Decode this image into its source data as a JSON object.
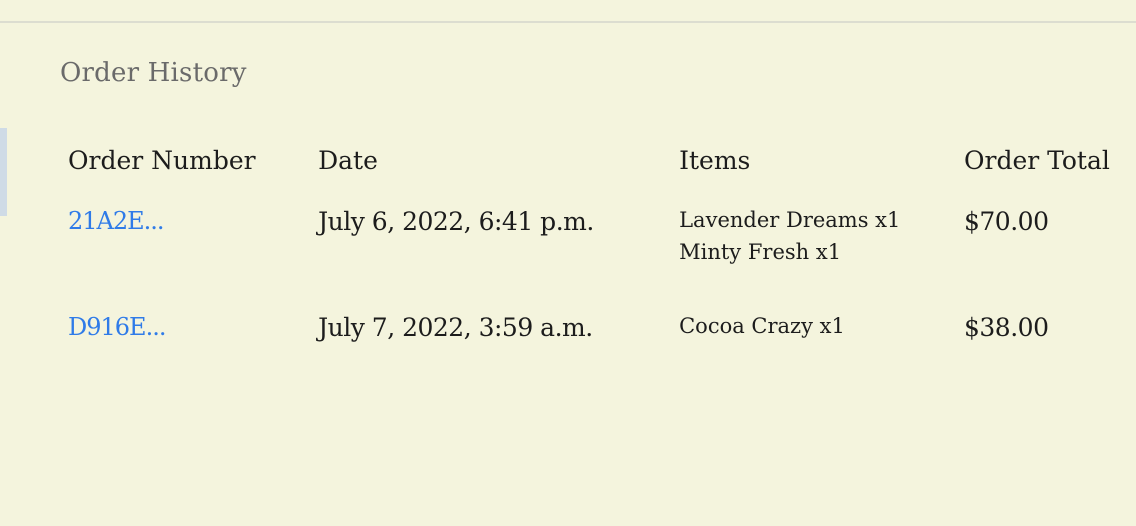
{
  "page": {
    "section_title": "Order History"
  },
  "table": {
    "headers": {
      "order_number": "Order Number",
      "date": "Date",
      "items": "Items",
      "order_total": "Order Total"
    },
    "rows": [
      {
        "order_number": "21A2E...",
        "date": "July 6, 2022, 6:41 p.m.",
        "items": [
          "Lavender Dreams x1",
          "Minty Fresh x1"
        ],
        "total": "$70.00"
      },
      {
        "order_number": "D916E...",
        "date": "July 7, 2022, 3:59 a.m.",
        "items": [
          "Cocoa Crazy x1"
        ],
        "total": "$38.00"
      }
    ]
  },
  "colors": {
    "background": "#f4f4dd",
    "link": "#2f7be8",
    "title": "#6a6a6a",
    "text": "#1c1c1c"
  }
}
